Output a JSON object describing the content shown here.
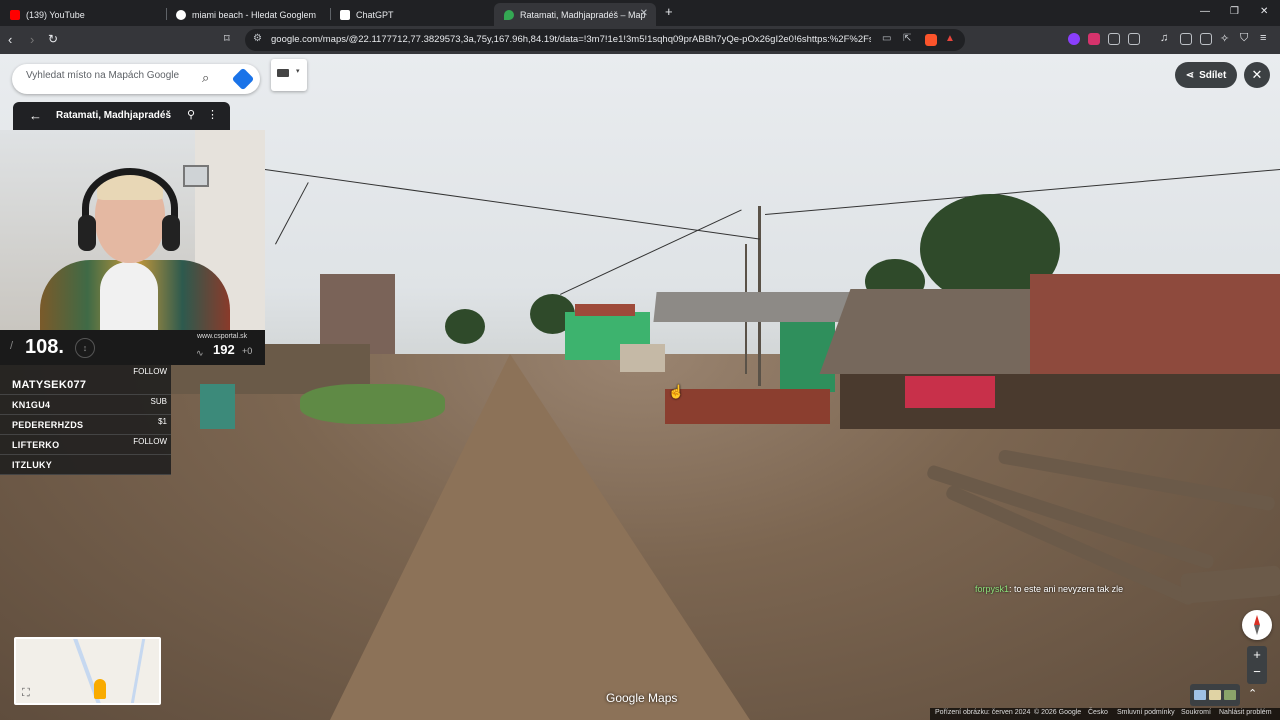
{
  "browser": {
    "tabs": [
      {
        "label": "(139) YouTube",
        "color": "#ff0000"
      },
      {
        "label": "miami beach - Hledat Googlem",
        "color": "#ffffff"
      },
      {
        "label": "ChatGPT",
        "color": "#ffffff"
      },
      {
        "label": "Ratamati, Madhjapradéš – Map",
        "color": "#34a853"
      }
    ],
    "url": "google.com/maps/@22.1177712,77.3829573,3a,75y,167.96h,84.19t/data=!3m7!1e1!3m5!1sqhq09prABBh7yQe-pOx26gI2e0!6shttps:%2F%2Fstre..."
  },
  "maps": {
    "search_placeholder": "Vyhledat místo na Mapách Google",
    "place_title": "Ratamati, Madhjapradéš",
    "share_label": "Sdílet",
    "watermark": "Google Maps",
    "footer": {
      "capture": "Pořízení obrázku: červen 2024",
      "copyright": "© 2026 Google",
      "lang": "Česko",
      "terms": "Smluvní podmínky",
      "privacy": "Soukromí",
      "report": "Nahlásit problém"
    }
  },
  "stream": {
    "rank": "108.",
    "site": "www.csportal.sk",
    "points": "192",
    "points_delta": "+0",
    "leaderboard": [
      {
        "name": "MATYSEK077",
        "tag": "FOLLOW"
      },
      {
        "name": "KN1GU4",
        "tag": "SUB"
      },
      {
        "name": "PEDERERHZDS",
        "tag": "$1"
      },
      {
        "name": "LIFTERKO",
        "tag": "FOLLOW"
      },
      {
        "name": "ITZLUKY",
        "tag": ""
      }
    ],
    "chat_user": "forpysk1",
    "chat_message": ": to este ani nevyzera tak zle"
  }
}
